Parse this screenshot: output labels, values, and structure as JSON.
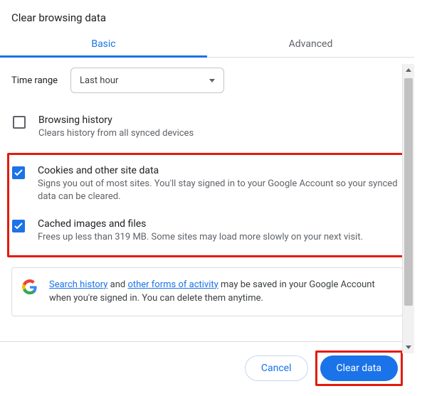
{
  "dialog": {
    "title": "Clear browsing data",
    "tabs": {
      "basic": "Basic",
      "advanced": "Advanced"
    },
    "time_range_label": "Time range",
    "time_range_value": "Last hour",
    "options": {
      "browsing_history": {
        "title": "Browsing history",
        "desc": "Clears history from all synced devices"
      },
      "cookies": {
        "title": "Cookies and other site data",
        "desc": "Signs you out of most sites. You'll stay signed in to your Google Account so your synced data can be cleared."
      },
      "cache": {
        "title": "Cached images and files",
        "desc": "Frees up less than 319 MB. Some sites may load more slowly on your next visit."
      }
    },
    "info": {
      "link1": "Search history",
      "mid1": " and ",
      "link2": "other forms of activity",
      "tail": " may be saved in your Google Account when you're signed in. You can delete them anytime."
    },
    "buttons": {
      "cancel": "Cancel",
      "clear": "Clear data"
    }
  }
}
